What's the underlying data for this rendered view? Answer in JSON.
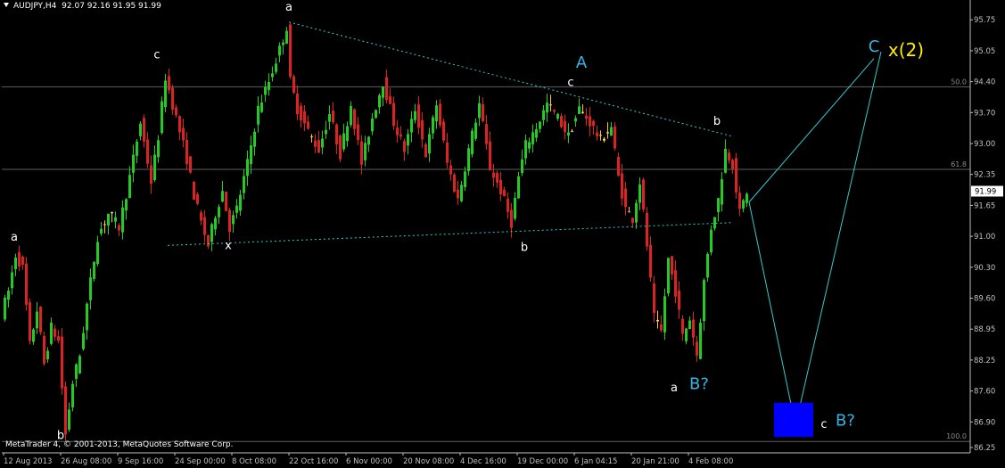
{
  "header": {
    "title": "AUDJPY,H4",
    "ohlc": "92.07 92.16 91.95 91.99"
  },
  "footer": {
    "copyright": "MetaTrader 4, © 2001-2013, MetaQuotes Software Corp."
  },
  "colors": {
    "background": "#000000",
    "bull_candle": "#22cc22",
    "bear_candle": "#dd2222",
    "doji_candle": "#ffcc33",
    "axis": "#c0c0c0",
    "fib_line": "#606060",
    "wave_label": "#ffffff",
    "wave_label_major": "#33b5e5",
    "wave_label_yellow": "#ffee00",
    "trend_line": "#33cccc",
    "target_box": "#0000ff"
  },
  "chart_data": {
    "type": "candlestick",
    "symbol": "AUDJPY",
    "timeframe": "H4",
    "ylim": [
      86.25,
      95.95
    ],
    "y_ticks": [
      "95.75",
      "95.05",
      "94.40",
      "93.70",
      "93.00",
      "92.35",
      "91.65",
      "91.00",
      "90.30",
      "89.60",
      "88.95",
      "88.25",
      "87.60",
      "86.90",
      "86.25"
    ],
    "x_ticks": [
      "12 Aug 2013",
      "26 Aug 08:00",
      "9 Sep 16:00",
      "24 Sep 00:00",
      "8 Oct 08:00",
      "22 Oct 16:00",
      "6 Nov 00:00",
      "20 Nov 08:00",
      "4 Dec 16:00",
      "19 Dec 00:00",
      "6 Jan 04:15",
      "20 Jan 21:00",
      "4 Feb 08:00"
    ],
    "last_price": "91.99",
    "fib_levels": [
      {
        "label": "50.0",
        "value": 94.28
      },
      {
        "label": "61.8",
        "value": 92.47
      },
      {
        "label": "100.0",
        "value": 86.5
      }
    ],
    "price_path": [
      [
        0,
        89.3
      ],
      [
        2,
        89.8
      ],
      [
        4,
        90.6
      ],
      [
        6,
        90.3
      ],
      [
        8,
        88.6
      ],
      [
        10,
        89.4
      ],
      [
        12,
        88.2
      ],
      [
        14,
        89.0
      ],
      [
        16,
        88.7
      ],
      [
        18,
        86.65
      ],
      [
        20,
        87.8
      ],
      [
        22,
        88.4
      ],
      [
        24,
        89.5
      ],
      [
        27,
        91.0
      ],
      [
        30,
        91.5
      ],
      [
        33,
        91.2
      ],
      [
        36,
        92.3
      ],
      [
        39,
        93.5
      ],
      [
        42,
        92.2
      ],
      [
        44,
        93.2
      ],
      [
        46,
        94.5
      ],
      [
        49,
        93.6
      ],
      [
        52,
        92.7
      ],
      [
        54,
        91.9
      ],
      [
        56,
        91.3
      ],
      [
        58,
        90.8
      ],
      [
        60,
        91.5
      ],
      [
        62,
        92.0
      ],
      [
        64,
        91.2
      ],
      [
        66,
        91.6
      ],
      [
        69,
        92.6
      ],
      [
        72,
        93.8
      ],
      [
        75,
        94.4
      ],
      [
        78,
        95.1
      ],
      [
        80,
        95.6
      ],
      [
        81,
        94.4
      ],
      [
        83,
        93.8
      ],
      [
        86,
        93.3
      ],
      [
        89,
        92.9
      ],
      [
        92,
        93.7
      ],
      [
        95,
        92.8
      ],
      [
        98,
        93.9
      ],
      [
        101,
        92.6
      ],
      [
        104,
        93.6
      ],
      [
        107,
        94.4
      ],
      [
        110,
        93.5
      ],
      [
        113,
        92.9
      ],
      [
        116,
        93.8
      ],
      [
        119,
        92.8
      ],
      [
        122,
        93.9
      ],
      [
        125,
        92.6
      ],
      [
        128,
        91.8
      ],
      [
        131,
        92.9
      ],
      [
        134,
        93.9
      ],
      [
        137,
        92.5
      ],
      [
        140,
        92.0
      ],
      [
        143,
        91.3
      ],
      [
        145,
        92.3
      ],
      [
        147,
        93.0
      ],
      [
        150,
        93.4
      ],
      [
        153,
        93.9
      ],
      [
        156,
        93.6
      ],
      [
        159,
        93.2
      ],
      [
        162,
        93.8
      ],
      [
        165,
        93.5
      ],
      [
        168,
        93.1
      ],
      [
        171,
        93.4
      ],
      [
        173,
        92.3
      ],
      [
        175,
        91.6
      ],
      [
        177,
        91.4
      ],
      [
        179,
        92.2
      ],
      [
        181,
        90.8
      ],
      [
        183,
        89.2
      ],
      [
        185,
        88.9
      ],
      [
        187,
        90.5
      ],
      [
        189,
        89.8
      ],
      [
        191,
        88.8
      ],
      [
        193,
        89.2
      ],
      [
        195,
        88.4
      ],
      [
        197,
        90.0
      ],
      [
        199,
        91.2
      ],
      [
        201,
        91.8
      ],
      [
        203,
        92.9
      ],
      [
        205,
        92.6
      ],
      [
        207,
        91.5
      ],
      [
        209,
        91.99
      ]
    ],
    "projection": [
      {
        "from": [
          209,
          91.75
        ],
        "to": [
          244,
          94.9
        ]
      },
      {
        "from": [
          209,
          91.75
        ],
        "to": [
          222,
          86.85
        ]
      },
      {
        "from": [
          222,
          86.85
        ],
        "to": [
          246,
          95.05
        ]
      }
    ],
    "trendlines": [
      {
        "from": [
          80,
          95.7
        ],
        "to": [
          204,
          93.2
        ]
      },
      {
        "from": [
          46,
          90.8
        ],
        "to": [
          204,
          91.3
        ]
      }
    ],
    "target_box": {
      "x0": 216,
      "x1": 227,
      "y0": 86.6,
      "y1": 87.35
    },
    "annotations": [
      {
        "text": "a",
        "x": 3,
        "y": 90.9,
        "style": "white"
      },
      {
        "text": "b",
        "x": 16,
        "y": 86.55,
        "style": "white"
      },
      {
        "text": "c",
        "x": 43,
        "y": 94.9,
        "style": "white"
      },
      {
        "text": "x",
        "x": 63,
        "y": 90.72,
        "style": "white"
      },
      {
        "text": "a",
        "x": 80,
        "y": 95.95,
        "style": "white"
      },
      {
        "text": "b",
        "x": 146,
        "y": 90.68,
        "style": "white"
      },
      {
        "text": "c",
        "x": 159,
        "y": 94.3,
        "style": "white"
      },
      {
        "text": "A",
        "x": 162,
        "y": 94.7,
        "style": "major"
      },
      {
        "text": "b",
        "x": 200,
        "y": 93.45,
        "style": "white"
      },
      {
        "text": "a",
        "x": 188,
        "y": 87.6,
        "style": "white"
      },
      {
        "text": "B?",
        "x": 195,
        "y": 87.65,
        "style": "major"
      },
      {
        "text": "C",
        "x": 244,
        "y": 95.05,
        "style": "major"
      },
      {
        "text": "x(2)",
        "x": 253,
        "y": 94.95,
        "style": "yellow"
      },
      {
        "text": "c",
        "x": 230,
        "y": 86.8,
        "style": "white"
      },
      {
        "text": "B?",
        "x": 236,
        "y": 86.85,
        "style": "major"
      }
    ]
  }
}
